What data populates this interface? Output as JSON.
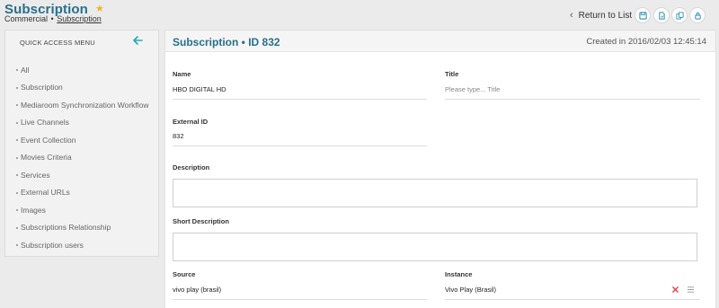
{
  "header": {
    "title": "Subscription",
    "breadcrumb": {
      "parent": "Commercial",
      "separator": "•",
      "current": "Subscription"
    },
    "return_label": "Return to List",
    "star_color": "#f0b429",
    "action_icons": [
      "save-icon",
      "save-copy-icon",
      "duplicate-icon",
      "lock-icon"
    ]
  },
  "sidebar": {
    "title": "QUICK ACCESS MENU",
    "items": [
      {
        "label": "All"
      },
      {
        "label": "Subscription"
      },
      {
        "label": "Mediaroom Synchronization Workflow"
      },
      {
        "label": "Live Channels"
      },
      {
        "label": "Event Collection"
      },
      {
        "label": "Movies Criteria"
      },
      {
        "label": "Services"
      },
      {
        "label": "External URLs"
      },
      {
        "label": "Images"
      },
      {
        "label": "Subscriptions Relationship"
      },
      {
        "label": "Subscription users"
      }
    ]
  },
  "main": {
    "title": "Subscription • ID 832",
    "created": "Created in 2016/02/03 12:45:14",
    "fields": {
      "name": {
        "label": "Name",
        "value": "HBO DIGITAL HD"
      },
      "title": {
        "label": "Title",
        "placeholder": "Please type... Title"
      },
      "external_id": {
        "label": "External ID",
        "value": "832"
      },
      "description": {
        "label": "Description",
        "value": ""
      },
      "short_description": {
        "label": "Short Description",
        "value": ""
      },
      "source": {
        "label": "Source",
        "value": "vivo play (brasil)"
      },
      "instance": {
        "label": "Instance",
        "value": "Vivo Play (Brasil)"
      }
    }
  },
  "colors": {
    "accent": "#2a6f8a",
    "teal_arrow": "#2aa7b8",
    "clear_red": "#e04040"
  }
}
